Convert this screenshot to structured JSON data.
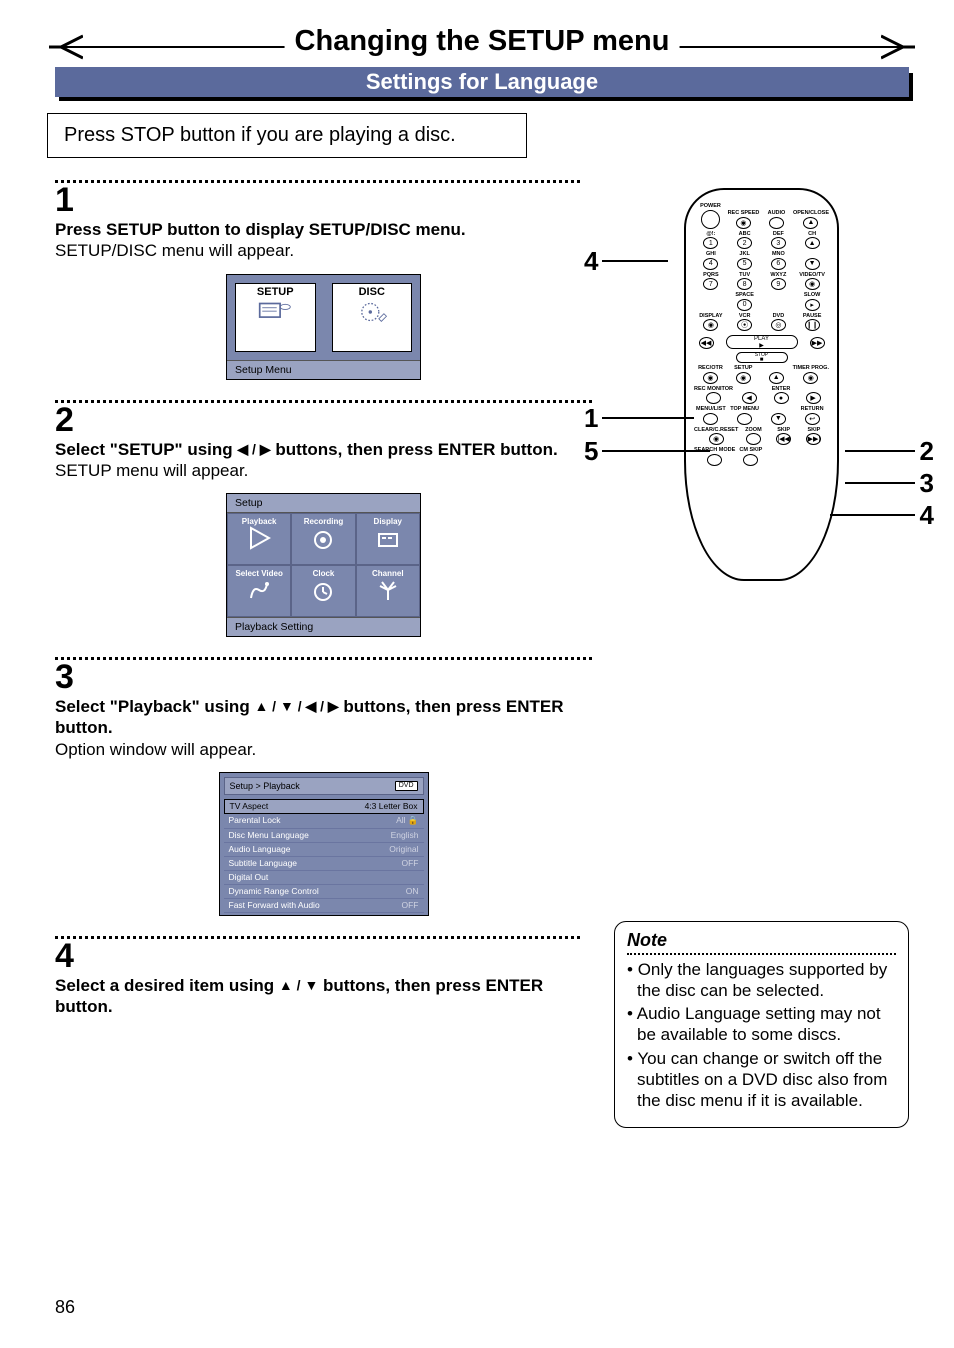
{
  "title": "Changing the SETUP menu",
  "subtitle": "Settings for Language",
  "intro": "Press STOP button if you are playing a disc.",
  "steps": {
    "s1": {
      "num": "1",
      "head": "Press SETUP button to display SETUP/DISC menu.",
      "body": "SETUP/DISC menu will appear."
    },
    "s2": {
      "num": "2",
      "head_a": "Select \"SETUP\" using ",
      "head_b": " buttons, then press ENTER button.",
      "body": "SETUP menu will appear."
    },
    "s3": {
      "num": "3",
      "head_a": "Select \"Playback\" using ",
      "head_b": " buttons, then press ENTER button.",
      "body": "Option window will appear."
    },
    "s4": {
      "num": "4",
      "head_a": "Select a desired item using ",
      "head_b": " buttons, then press ENTER button."
    }
  },
  "arrows": {
    "lr": "◀ / ▶",
    "udlr": "▲ / ▼ / ◀ / ▶",
    "ud": "▲ / ▼"
  },
  "menu1": {
    "card1": "SETUP",
    "card2": "DISC",
    "footer": "Setup Menu"
  },
  "menu2": {
    "title": "Setup",
    "cells": [
      "Playback",
      "Recording",
      "Display",
      "Select Video",
      "Clock",
      "Channel"
    ],
    "footer": "Playback Setting"
  },
  "menu3": {
    "crumb": "Setup > Playback",
    "badge": "DVD",
    "rows": [
      {
        "k": "TV Aspect",
        "v": "4:3 Letter Box",
        "sel": true
      },
      {
        "k": "Parental Lock",
        "v": "All",
        "lock": true
      },
      {
        "k": "Disc Menu Language",
        "v": "English"
      },
      {
        "k": "Audio Language",
        "v": "Original"
      },
      {
        "k": "Subtitle Language",
        "v": "OFF"
      },
      {
        "k": "Digital Out",
        "v": ""
      },
      {
        "k": "Dynamic Range Control",
        "v": "ON"
      },
      {
        "k": "Fast Forward with Audio",
        "v": "OFF"
      }
    ]
  },
  "remote": {
    "row1": [
      "POWER",
      "REC SPEED",
      "AUDIO",
      "OPEN/CLOSE"
    ],
    "numpad": [
      [
        "@!:",
        "1",
        "ABC",
        "2",
        "DEF",
        "3"
      ],
      [
        "GHI",
        "4",
        "JKL",
        "5",
        "MNO",
        "6"
      ],
      [
        "PQRS",
        "7",
        "TUV",
        "8",
        "WXYZ",
        "9"
      ]
    ],
    "zero_row": {
      "space": "SPACE",
      "zero": "0",
      "slow": "SLOW"
    },
    "disp_row": [
      "DISPLAY",
      "VCR",
      "DVD",
      "PAUSE"
    ],
    "play": "PLAY",
    "stop": "STOP",
    "rec_row": [
      "REC/OTR",
      "SETUP",
      "",
      "TIMER PROG."
    ],
    "enter_row": [
      "REC MONITOR",
      "",
      "ENTER",
      ""
    ],
    "menu_row": [
      "MENU/LIST",
      "TOP MENU",
      "",
      "RETURN"
    ],
    "zoom_row": [
      "CLEAR/C.RESET",
      "ZOOM",
      "SKIP",
      "SKIP"
    ],
    "last_row": [
      "SEARCH MODE",
      "CM SKIP"
    ],
    "ch": "CH",
    "video": "VIDEO/TV"
  },
  "callouts": {
    "c4l": "4",
    "c1l": "1",
    "c5l": "5",
    "c2r": "2",
    "c3r": "3",
    "c4r": "4"
  },
  "note": {
    "title": "Note",
    "items": [
      "Only the languages supported by the disc can be selected.",
      "Audio Language setting may not be available to some discs.",
      "You can change or switch off the subtitles on a DVD disc also from the disc menu if it is available."
    ]
  },
  "page_number": "86"
}
